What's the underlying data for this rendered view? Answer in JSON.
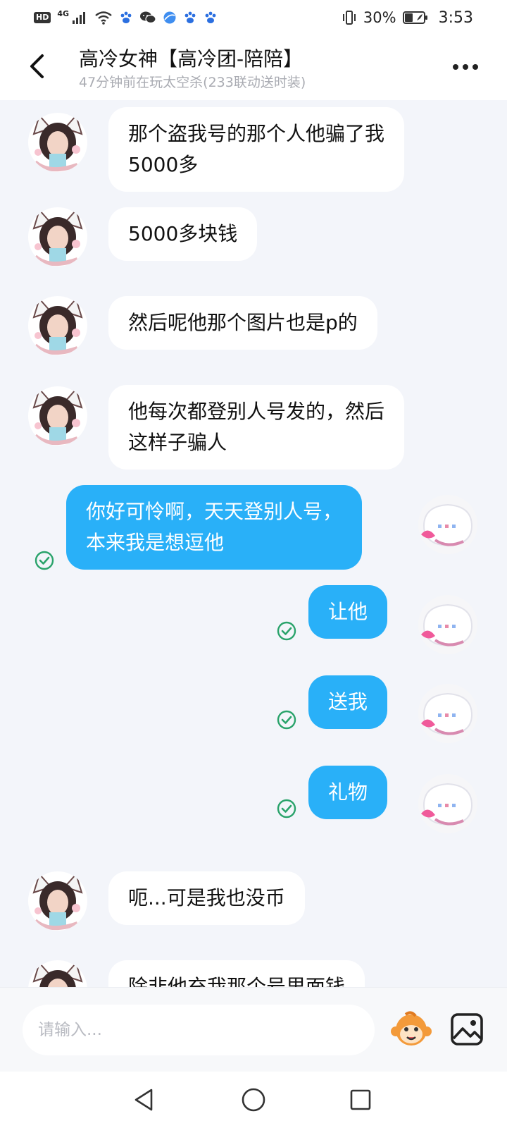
{
  "status_bar": {
    "hd_label": "HD",
    "network_type": "4G",
    "battery_percent": "30%",
    "time": "3:53",
    "icons": [
      "hd-icon",
      "signal-icon",
      "wifi-icon",
      "baidu-paw-icon",
      "wechat-icon",
      "browser-icon",
      "baidu-paw-icon",
      "baidu-paw-icon",
      "vibrate-icon",
      "battery-icon"
    ]
  },
  "header": {
    "title": "高冷女神【高冷团-陪陪】",
    "subtitle": "47分钟前在玩太空杀(233联动送时装)"
  },
  "messages": [
    {
      "side": "in",
      "lines": [
        "那个盗我号的那个人他骗了我",
        "5000多"
      ]
    },
    {
      "side": "in",
      "lines": [
        "5000多块钱"
      ]
    },
    {
      "side": "in",
      "lines": [
        "然后呢他那个图片也是p的"
      ]
    },
    {
      "side": "in",
      "lines": [
        "他每次都登别人号发的，然后",
        "这样子骗人"
      ]
    },
    {
      "side": "out",
      "lines": [
        "你好可怜啊，天天登别人号，",
        "本来我是想逗他"
      ],
      "read": true
    },
    {
      "side": "out",
      "lines": [
        "让他"
      ],
      "read": true
    },
    {
      "side": "out",
      "lines": [
        "送我"
      ],
      "read": true
    },
    {
      "side": "out",
      "lines": [
        "礼物"
      ],
      "read": true
    },
    {
      "side": "in",
      "lines": [
        "呃...可是我也没币"
      ]
    },
    {
      "side": "in",
      "lines": [
        "除非他充我那个号里面钱"
      ]
    }
  ],
  "input": {
    "placeholder": "请输入..."
  },
  "colors": {
    "outgoing_bubble": "#29b0f8",
    "incoming_bubble": "#ffffff",
    "read_check": "#2aa36b",
    "chat_background": "#f3f5fa"
  }
}
